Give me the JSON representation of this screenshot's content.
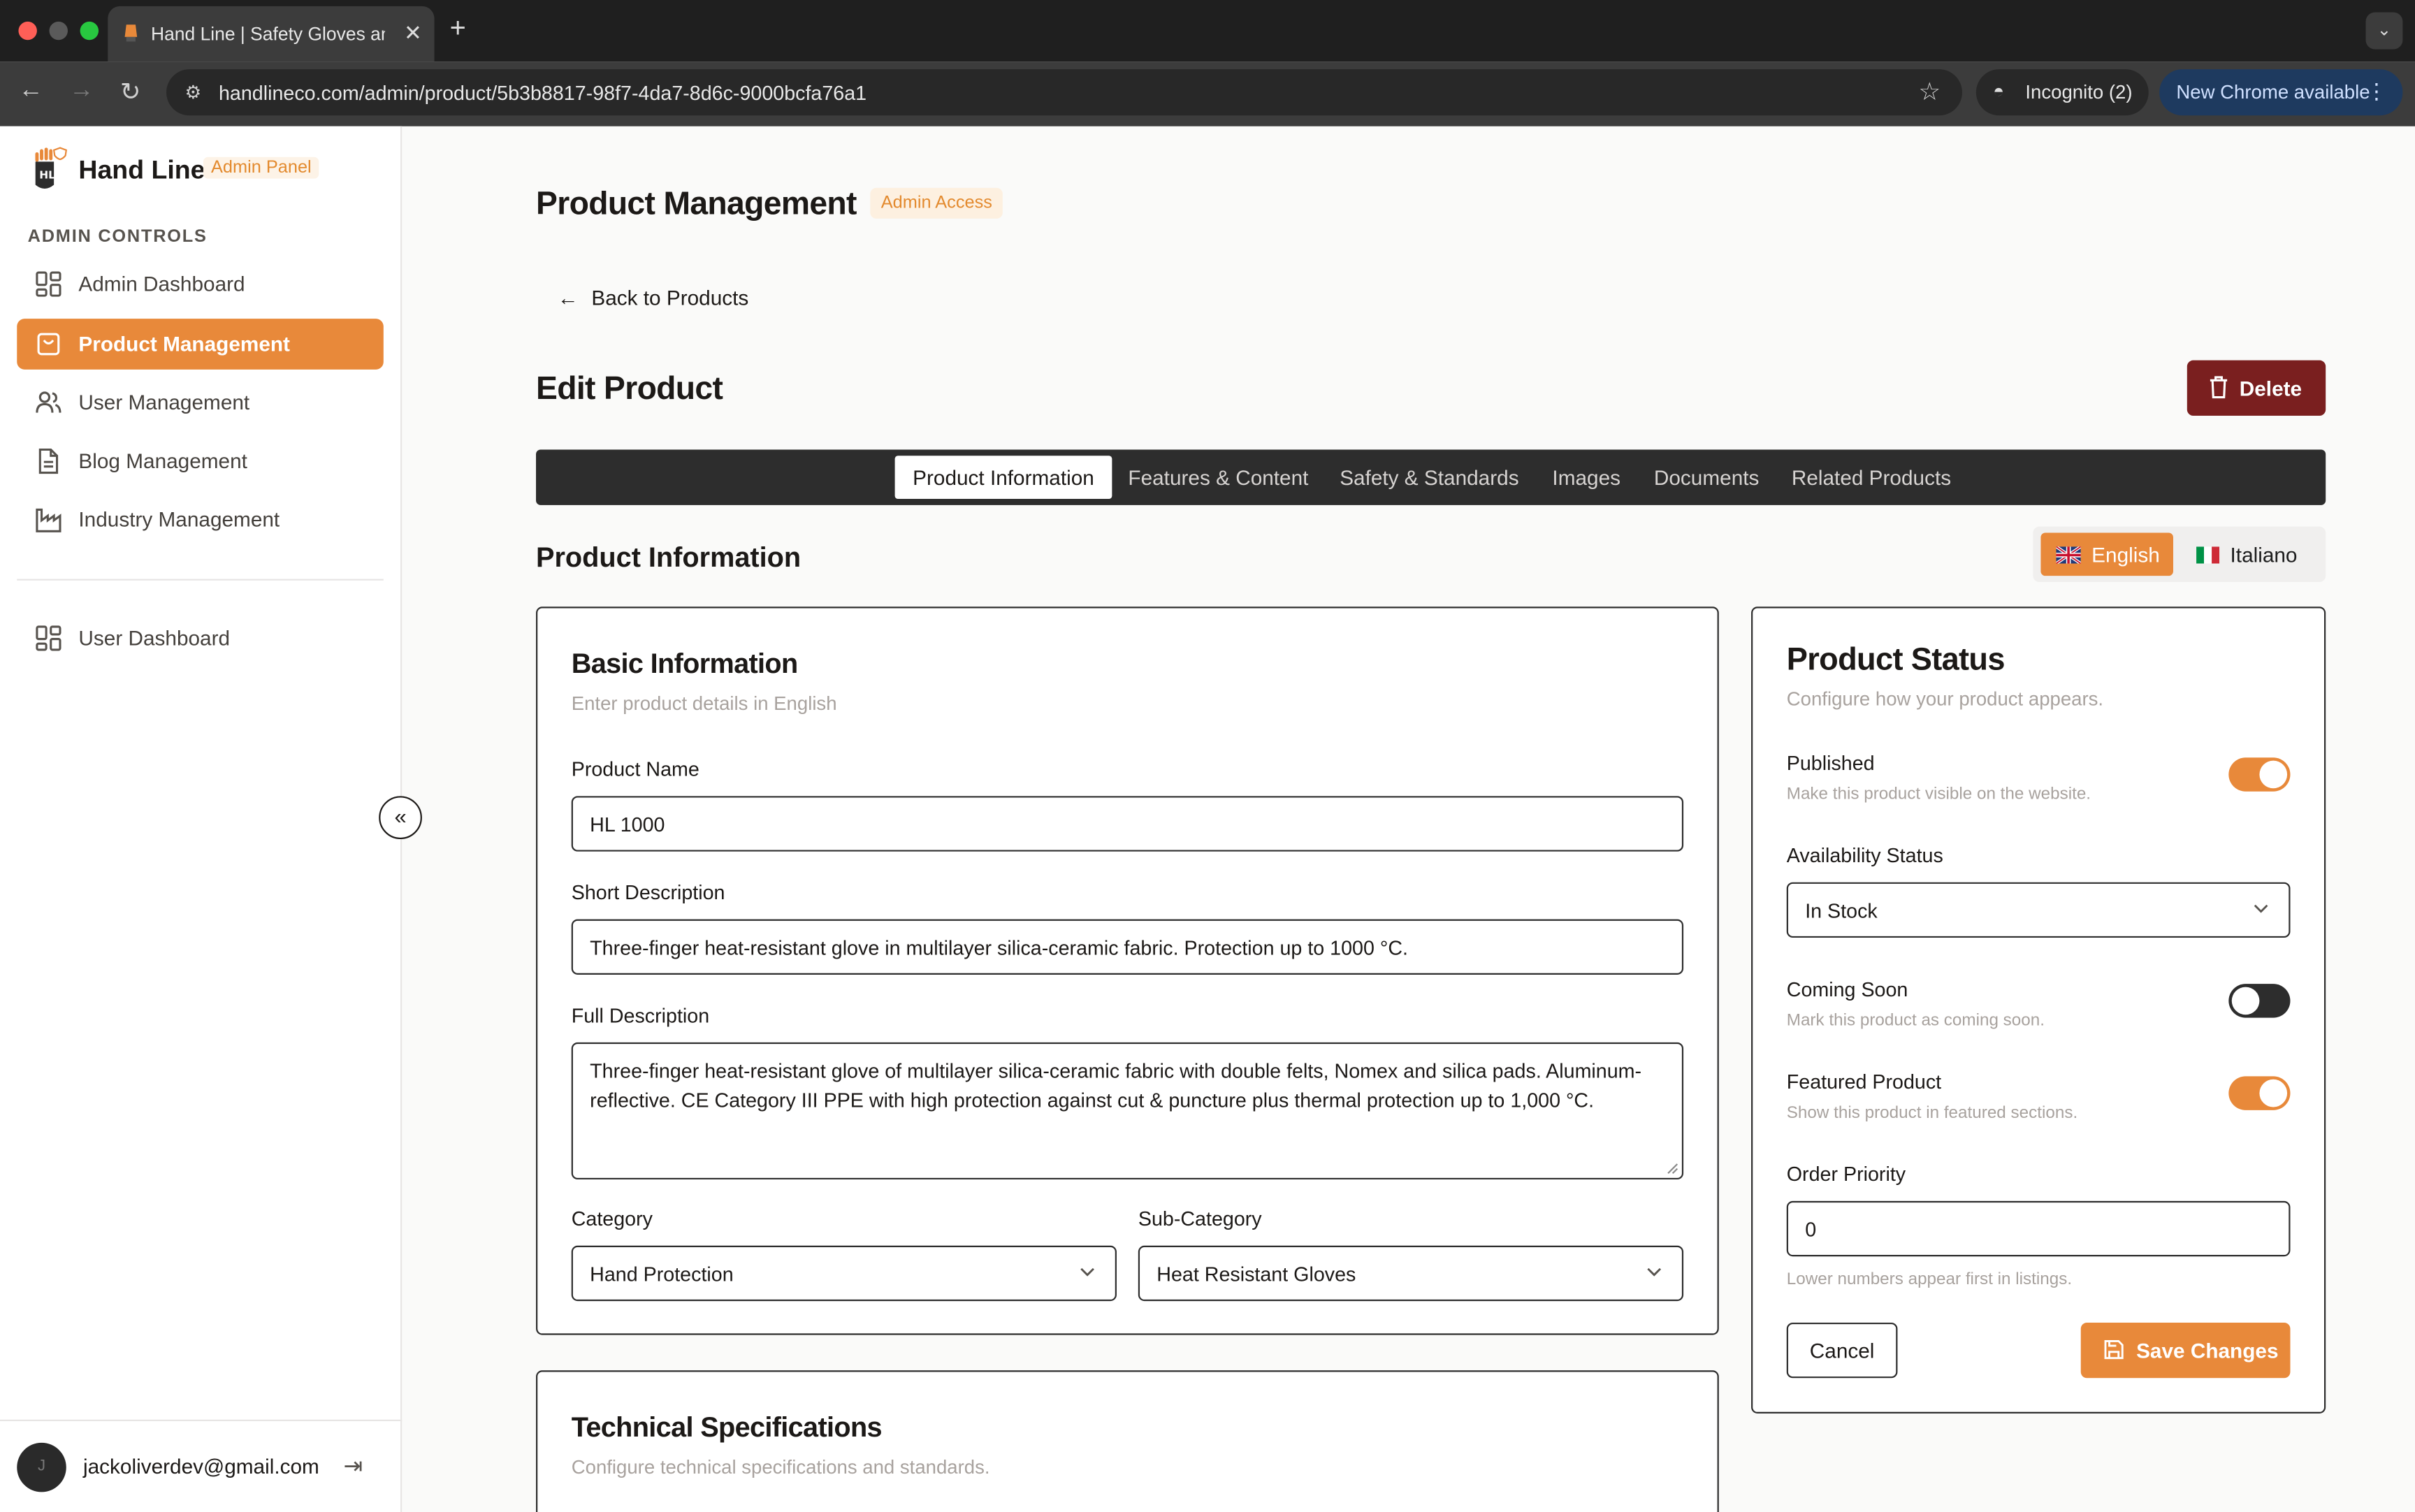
{
  "browser": {
    "tab_title": "Hand Line | Safety Gloves and",
    "url": "handlineco.com/admin/product/5b3b8817-98f7-4da7-8d6c-9000bcfa76a1",
    "incognito_label": "Incognito (2)",
    "update_label": "New Chrome available"
  },
  "sidebar": {
    "brand": "Hand Line",
    "badge": "Admin Panel",
    "section_label": "ADMIN CONTROLS",
    "items": [
      {
        "label": "Admin Dashboard",
        "icon": "grid-icon",
        "active": false
      },
      {
        "label": "Product Management",
        "icon": "shopping-bag-icon",
        "active": true
      },
      {
        "label": "User Management",
        "icon": "users-icon",
        "active": false
      },
      {
        "label": "Blog Management",
        "icon": "document-icon",
        "active": false
      },
      {
        "label": "Industry Management",
        "icon": "factory-icon",
        "active": false
      }
    ],
    "secondary_items": [
      {
        "label": "User Dashboard",
        "icon": "grid-icon"
      }
    ],
    "user_email": "jackoliverdev@gmail.com",
    "avatar_initial": "J"
  },
  "header": {
    "title": "Product Management",
    "badge": "Admin Access",
    "back_label": "Back to Products",
    "edit_title": "Edit Product",
    "delete_label": "Delete"
  },
  "tabs": [
    {
      "label": "Product Information",
      "active": true
    },
    {
      "label": "Features & Content",
      "active": false
    },
    {
      "label": "Safety & Standards",
      "active": false
    },
    {
      "label": "Images",
      "active": false
    },
    {
      "label": "Documents",
      "active": false
    },
    {
      "label": "Related Products",
      "active": false
    }
  ],
  "section_title": "Product Information",
  "languages": [
    {
      "label": "English",
      "active": true
    },
    {
      "label": "Italiano",
      "active": false
    }
  ],
  "basic_info": {
    "title": "Basic Information",
    "subtitle": "Enter product details in English",
    "product_name_label": "Product Name",
    "product_name": "HL 1000",
    "short_desc_label": "Short Description",
    "short_desc": "Three-finger heat-resistant glove in multilayer silica-ceramic fabric. Protection up to 1000 °C.",
    "full_desc_label": "Full Description",
    "full_desc": "Three-finger heat-resistant glove of multilayer silica-ceramic fabric with double felts, Nomex and silica pads. Aluminum-reflective. CE Category III PPE with high protection against cut & puncture plus thermal protection up to 1,000 °C.",
    "category_label": "Category",
    "category": "Hand Protection",
    "subcategory_label": "Sub-Category",
    "subcategory": "Heat Resistant Gloves"
  },
  "tech_specs": {
    "title": "Technical Specifications",
    "subtitle": "Configure technical specifications and standards."
  },
  "status": {
    "title": "Product Status",
    "subtitle": "Configure how your product appears.",
    "published_label": "Published",
    "published_desc": "Make this product visible on the website.",
    "published": true,
    "availability_label": "Availability Status",
    "availability": "In Stock",
    "coming_soon_label": "Coming Soon",
    "coming_soon_desc": "Mark this product as coming soon.",
    "coming_soon": false,
    "featured_label": "Featured Product",
    "featured_desc": "Show this product in featured sections.",
    "featured": true,
    "order_label": "Order Priority",
    "order_value": "0",
    "order_hint": "Lower numbers appear first in listings.",
    "cancel_label": "Cancel",
    "save_label": "Save Changes"
  },
  "colors": {
    "accent": "#e8893a",
    "danger": "#7a1f1f",
    "dark": "#2d2d2d"
  }
}
